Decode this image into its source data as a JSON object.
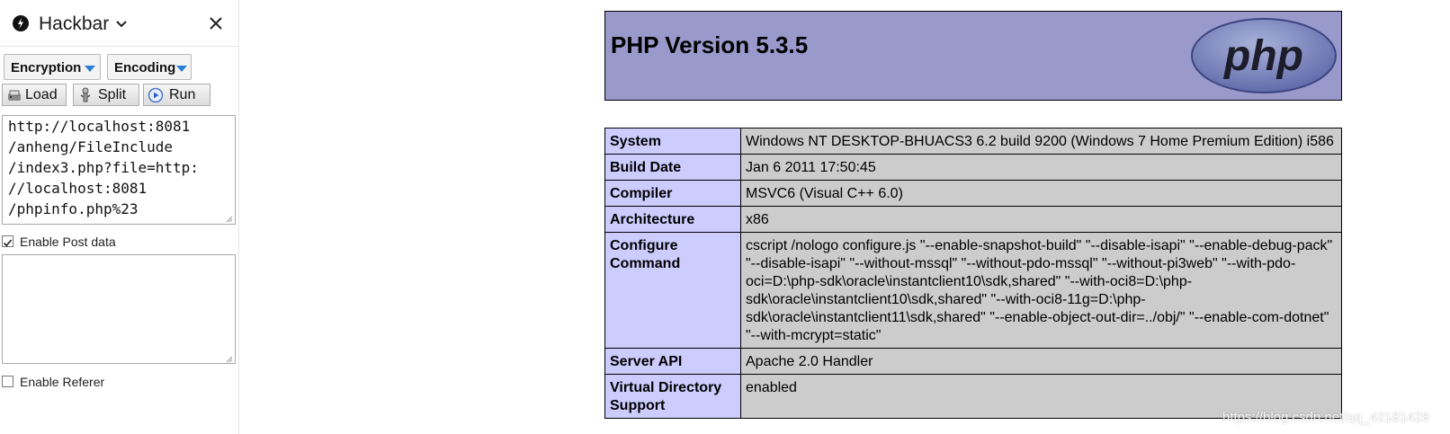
{
  "hackbar": {
    "title": "Hackbar",
    "encryption_label": "Encryption",
    "encoding_label": "Encoding",
    "buttons": {
      "load": "Load",
      "split": "Split",
      "run": "Run"
    },
    "url_value": "http://localhost:8081\n/anheng/FileInclude\n/index3.php?file=http:\n//localhost:8081\n/phpinfo.php%23",
    "post_data_label": "Enable Post data",
    "post_data_checked": true,
    "post_value": "",
    "referer_label": "Enable Referer",
    "referer_checked": false,
    "icons": [
      "hackbar-logo-icon",
      "chevron-down-icon",
      "close-icon",
      "load-icon",
      "split-icon",
      "run-icon"
    ]
  },
  "php": {
    "title": "PHP Version 5.3.5",
    "logo_text": "php",
    "colors": {
      "header_bg": "#9999cc",
      "label_bg": "#ccccff",
      "value_bg": "#cccccc"
    },
    "rows": [
      {
        "label": "System",
        "value": "Windows NT DESKTOP-BHUACS3 6.2 build 9200 (Windows 7 Home Premium Edition) i586"
      },
      {
        "label": "Build Date",
        "value": "Jan 6 2011 17:50:45"
      },
      {
        "label": "Compiler",
        "value": "MSVC6 (Visual C++ 6.0)"
      },
      {
        "label": "Architecture",
        "value": "x86"
      },
      {
        "label": "Configure Command",
        "value": "cscript /nologo configure.js \"--enable-snapshot-build\" \"--disable-isapi\" \"--enable-debug-pack\" \"--disable-isapi\" \"--without-mssql\" \"--without-pdo-mssql\" \"--without-pi3web\" \"--with-pdo-oci=D:\\php-sdk\\oracle\\instantclient10\\sdk,shared\" \"--with-oci8=D:\\php-sdk\\oracle\\instantclient10\\sdk,shared\" \"--with-oci8-11g=D:\\php-sdk\\oracle\\instantclient11\\sdk,shared\" \"--enable-object-out-dir=../obj/\" \"--enable-com-dotnet\" \"--with-mcrypt=static\""
      },
      {
        "label": "Server API",
        "value": "Apache 2.0 Handler"
      },
      {
        "label": "Virtual Directory Support",
        "value": "enabled"
      }
    ]
  },
  "watermark": "https://blog.csdn.net/qq_42181428"
}
